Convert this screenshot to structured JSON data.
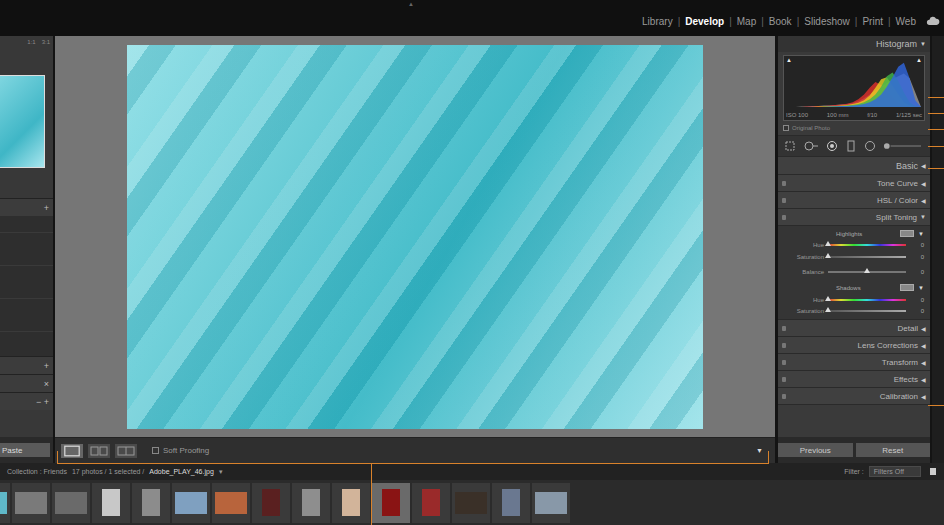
{
  "top_bar": {
    "panel_toggle": "▲",
    "separator": "|",
    "modules": [
      {
        "label": "Library",
        "selected": false
      },
      {
        "label": "Develop",
        "selected": true
      },
      {
        "label": "Map",
        "selected": false
      },
      {
        "label": "Book",
        "selected": false
      },
      {
        "label": "Slideshow",
        "selected": false
      },
      {
        "label": "Print",
        "selected": false
      },
      {
        "label": "Web",
        "selected": false
      }
    ]
  },
  "left_panel": {
    "zoom_options": [
      "1:1",
      "3:1"
    ],
    "sections": [
      {
        "icon": "+"
      },
      {
        "icon": "+"
      },
      {
        "icon": "×"
      },
      {
        "icon": "− +"
      }
    ],
    "paste_button": "Paste"
  },
  "viewer": {
    "toolbar": {
      "soft_proofing": {
        "label": "Soft Proofing",
        "checked": false
      },
      "menu_icon": "▼"
    }
  },
  "histogram": {
    "title": "Histogram",
    "arrow": "▼",
    "clip_icons": [
      "▲",
      "▲"
    ],
    "series": [
      {
        "name": "luminance",
        "color": "#9a9a9a",
        "values": [
          0,
          0,
          1,
          1,
          2,
          2,
          3,
          3,
          4,
          5,
          6,
          8,
          12,
          18,
          26,
          34,
          42,
          50,
          58,
          64,
          70,
          60,
          30,
          0
        ]
      },
      {
        "name": "red",
        "color": "#e2302a",
        "values": [
          0,
          0,
          0,
          1,
          1,
          2,
          2,
          3,
          4,
          5,
          7,
          10,
          16,
          26,
          40,
          52,
          46,
          34,
          20,
          10,
          4,
          1,
          0,
          0
        ]
      },
      {
        "name": "yellow",
        "color": "#e8d020",
        "values": [
          0,
          0,
          0,
          0,
          0,
          1,
          1,
          2,
          2,
          3,
          4,
          6,
          9,
          14,
          24,
          40,
          58,
          62,
          44,
          26,
          10,
          3,
          0,
          0
        ]
      },
      {
        "name": "green",
        "color": "#3fb64a",
        "values": [
          0,
          0,
          0,
          0,
          0,
          0,
          1,
          1,
          2,
          2,
          3,
          4,
          6,
          10,
          16,
          26,
          42,
          64,
          72,
          54,
          30,
          10,
          2,
          0
        ]
      },
      {
        "name": "blue",
        "color": "#2f66e0",
        "values": [
          0,
          0,
          0,
          0,
          0,
          0,
          0,
          1,
          1,
          2,
          2,
          3,
          4,
          6,
          10,
          16,
          26,
          42,
          62,
          84,
          92,
          60,
          14,
          0
        ]
      }
    ],
    "exif": [
      "ISO 100",
      "100 mm",
      "f/10",
      "1/125 sec"
    ],
    "original_photo": {
      "label": "Original Photo",
      "checked": false
    }
  },
  "panels": [
    {
      "label": "Basic",
      "arrow": "◀",
      "expanded": false,
      "has_switch": false
    },
    {
      "label": "Tone Curve",
      "arrow": "◀",
      "expanded": false,
      "has_switch": true
    },
    {
      "label": "HSL / Color",
      "arrow": "◀",
      "expanded": false,
      "has_switch": true
    },
    {
      "label": "Split Toning",
      "arrow": "▼",
      "expanded": true,
      "has_switch": true
    },
    {
      "label": "Detail",
      "arrow": "◀",
      "expanded": false,
      "has_switch": true
    },
    {
      "label": "Lens Corrections",
      "arrow": "◀",
      "expanded": false,
      "has_switch": true
    },
    {
      "label": "Transform",
      "arrow": "◀",
      "expanded": false,
      "has_switch": true
    },
    {
      "label": "Effects",
      "arrow": "◀",
      "expanded": false,
      "has_switch": true
    },
    {
      "label": "Calibration",
      "arrow": "◀",
      "expanded": false,
      "has_switch": true
    }
  ],
  "split_toning": {
    "groups": [
      {
        "title": "Highlights",
        "menu_icon": "▼",
        "sliders": [
          {
            "label": "Hue",
            "value": "0",
            "level": 0,
            "kind": "hue"
          },
          {
            "label": "Saturation",
            "value": "0",
            "level": 0,
            "kind": "saturation"
          }
        ]
      },
      {
        "title": "Shadows",
        "menu_icon": "▼",
        "sliders": [
          {
            "label": "Hue",
            "value": "0",
            "level": 0,
            "kind": "hue"
          },
          {
            "label": "Saturation",
            "value": "0",
            "level": 0,
            "kind": "saturation"
          }
        ]
      }
    ],
    "balance": {
      "label": "Balance",
      "value": "0",
      "level": 0.5,
      "kind": "balance"
    }
  },
  "buttons": [
    {
      "label": "Previous"
    },
    {
      "label": "Reset"
    }
  ],
  "filmstrip": {
    "collection": "Collection : Friends",
    "count": "17 photos / 1 selected /",
    "file": "Adobe_PLAY_46.jpg",
    "file_menu_icon": "▾",
    "filter_label": "Filter :",
    "filter_value": "Filters Off",
    "thumbnails": [
      {
        "kind": "landscape",
        "color": "#5fb8c8",
        "selected": false
      },
      {
        "kind": "landscape",
        "color": "#7a7a7a",
        "selected": false
      },
      {
        "kind": "landscape",
        "color": "#6a6a6a",
        "selected": false
      },
      {
        "kind": "portrait",
        "color": "#c8c8c8",
        "selected": false
      },
      {
        "kind": "portrait",
        "color": "#8c8c8c",
        "selected": false
      },
      {
        "kind": "landscape",
        "color": "#7fa0c0",
        "selected": false
      },
      {
        "kind": "landscape",
        "color": "#b8643c",
        "selected": false
      },
      {
        "kind": "portrait",
        "color": "#5a2020",
        "selected": false
      },
      {
        "kind": "portrait",
        "color": "#8e8e8e",
        "selected": false
      },
      {
        "kind": "portrait",
        "color": "#d2b49a",
        "selected": false
      },
      {
        "kind": "portrait",
        "color": "#8a1414",
        "selected": true
      },
      {
        "kind": "portrait",
        "color": "#9a2a2a",
        "selected": false
      },
      {
        "kind": "landscape",
        "color": "#3a3028",
        "selected": false
      },
      {
        "kind": "portrait",
        "color": "#6a7890",
        "selected": false
      },
      {
        "kind": "landscape",
        "color": "#8898a8",
        "selected": false
      }
    ]
  }
}
